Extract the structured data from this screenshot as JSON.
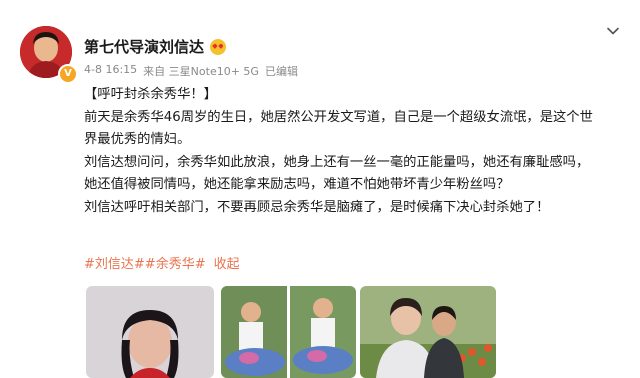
{
  "post": {
    "author": "第七代导演刘信达",
    "verified_badge": "V",
    "meta": {
      "date": "4-8 16:15",
      "source": "来自 三星Note10+ 5G",
      "edited": "已编辑"
    },
    "lines": [
      "【呼吁封杀余秀华！】",
      "前天是余秀华46周岁的生日，她居然公开发文写道，自己是一个超级女流氓，是这个世",
      "界最优秀的情妇。",
      "刘信达想问问，余秀华如此放浪，她身上还有一丝一毫的正能量吗，她还有廉耻感吗，",
      "她还值得被同情吗，她还能拿来励志吗，难道不怕她带坏青少年粉丝吗？",
      "刘信达呼吁相关部门，不要再顾忌余秀华是脑瘫了，是时候痛下决心封杀她了！"
    ],
    "tags": [
      "#刘信达#",
      "#余秀华#"
    ],
    "collapse_label": "收起"
  },
  "icons": {
    "menu": "chevron-down-icon",
    "emoji": "heart-eyes-emoji-icon"
  },
  "colors": {
    "tag": "#eb7350",
    "meta": "#8a8a8a",
    "badge": "#f5a623"
  }
}
